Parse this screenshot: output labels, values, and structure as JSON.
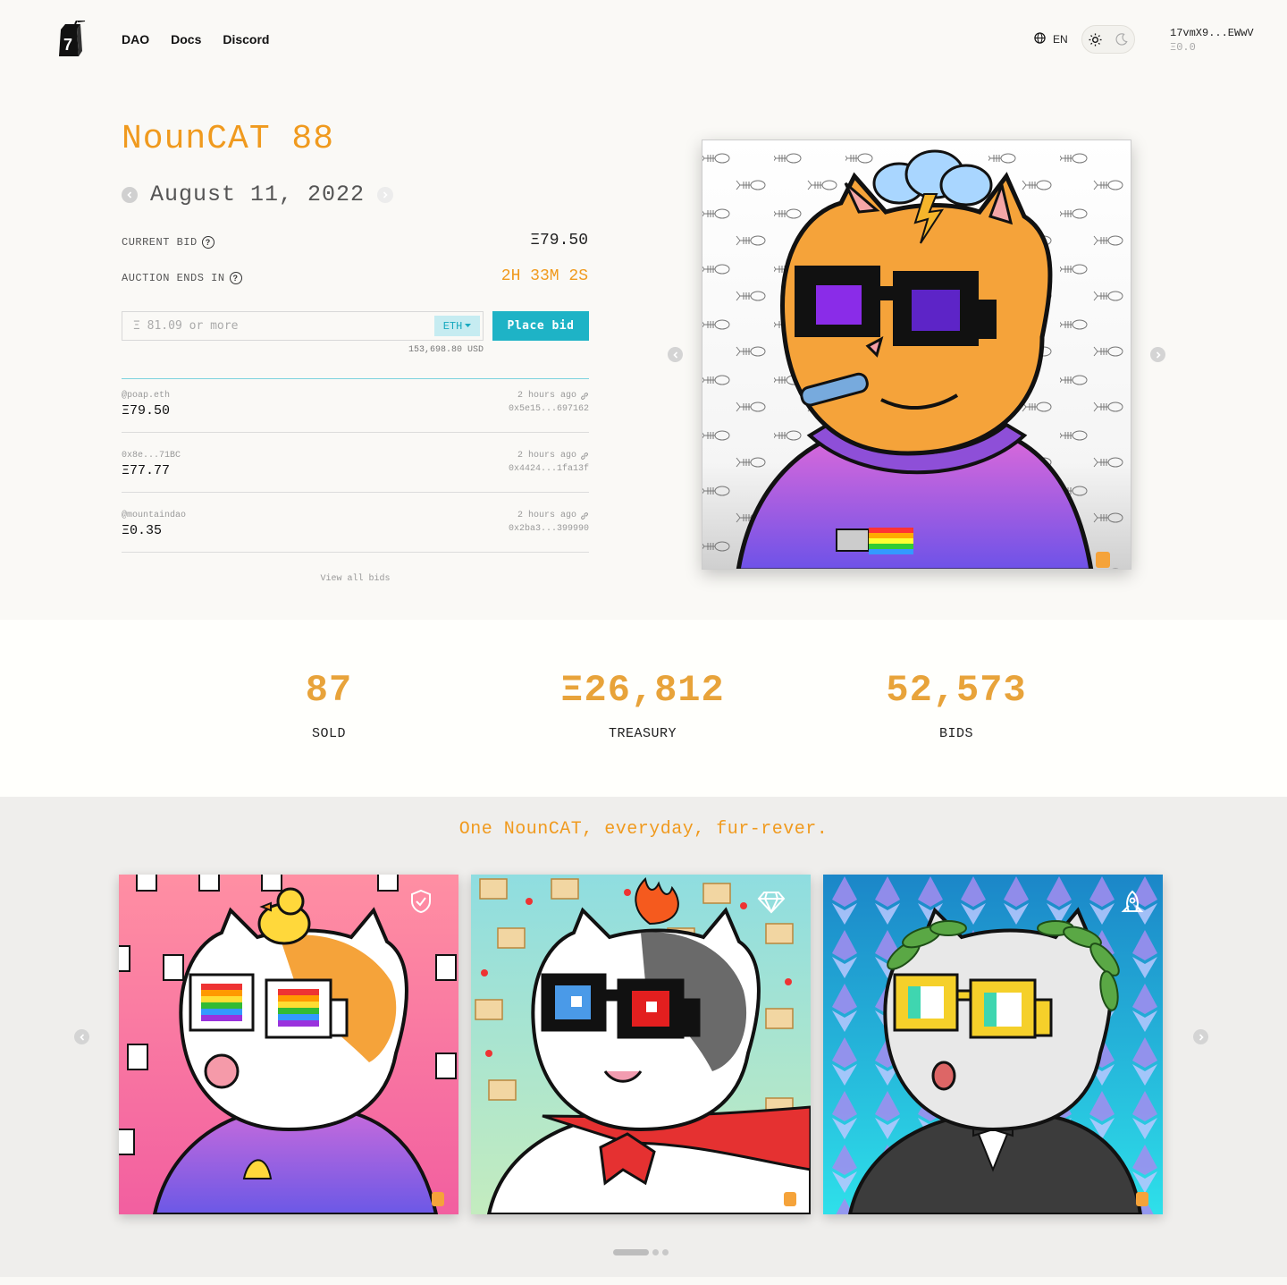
{
  "nav": {
    "dao": "DAO",
    "docs": "Docs",
    "discord": "Discord"
  },
  "header": {
    "lang": "EN",
    "wallet_address": "17vmX9...EWwV",
    "wallet_balance": "Ξ0.0"
  },
  "auction": {
    "title": "NounCAT 88",
    "date": "August 11, 2022",
    "current_bid_label": "CURRENT BID",
    "current_bid": "Ξ79.50",
    "ends_label": "AUCTION ENDS IN",
    "ends_value": "2H 33M 2S",
    "bid_placeholder": "Ξ 81.09 or more",
    "currency": "ETH",
    "place_bid": "Place bid",
    "usd": "153,698.80 USD",
    "view_all": "View all bids"
  },
  "bids": [
    {
      "bidder": "@poap.eth",
      "amount": "Ξ79.50",
      "time": "2 hours ago",
      "tx": "0x5e15...697162"
    },
    {
      "bidder": "0x8e...71BC",
      "amount": "Ξ77.77",
      "time": "2 hours ago",
      "tx": "0x4424...1fa13f"
    },
    {
      "bidder": "@mountaindao",
      "amount": "Ξ0.35",
      "time": "2 hours ago",
      "tx": "0x2ba3...399990"
    }
  ],
  "stats": [
    {
      "value": "87",
      "label": "SOLD"
    },
    {
      "value": "Ξ26,812",
      "label": "TREASURY"
    },
    {
      "value": "52,573",
      "label": "BIDS"
    }
  ],
  "gallery": {
    "tagline": "One NounCAT, everyday, fur-rever.",
    "cards": [
      {
        "badge": "shield-check-icon"
      },
      {
        "badge": "diamond-icon"
      },
      {
        "badge": "rocket-icon"
      }
    ],
    "active_dot": 0,
    "dot_count": 3
  },
  "colors": {
    "accent": "#f09a1e",
    "button": "#1eb3c6",
    "stat": "#e8a33a"
  }
}
